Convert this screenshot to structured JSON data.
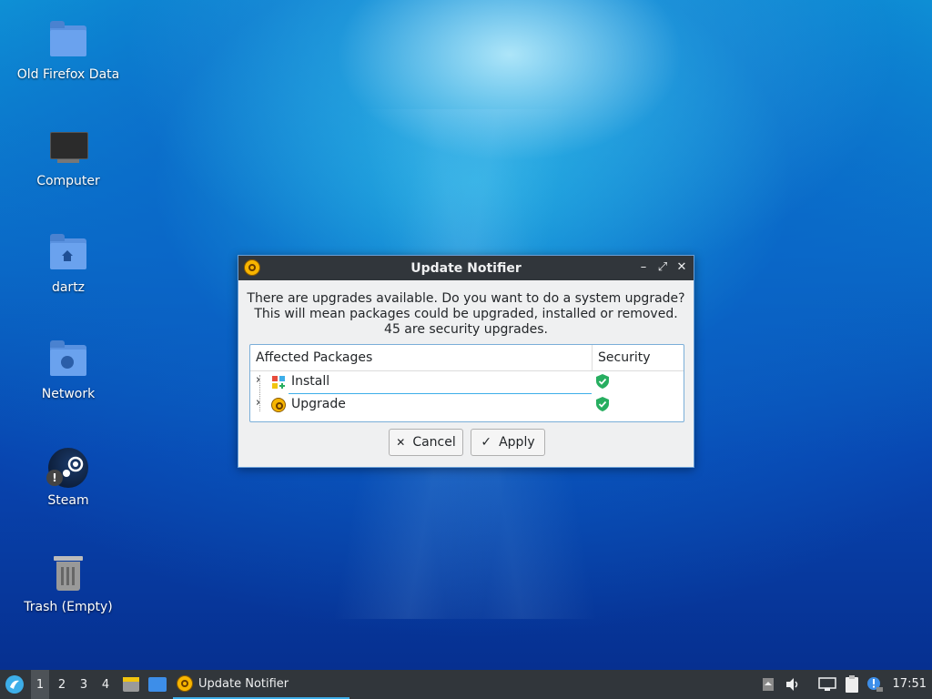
{
  "desktop": {
    "icons": [
      {
        "label": "Old Firefox Data",
        "icon": "folder-icon"
      },
      {
        "label": "Computer",
        "icon": "computer-icon"
      },
      {
        "label": "dartz",
        "icon": "home-folder-icon"
      },
      {
        "label": "Network",
        "icon": "network-folder-icon"
      },
      {
        "label": "Steam",
        "icon": "steam-icon"
      },
      {
        "label": "Trash (Empty)",
        "icon": "trash-icon"
      }
    ]
  },
  "dialog": {
    "title": "Update Notifier",
    "message_line1": "There are upgrades available. Do you want to do a system upgrade?",
    "message_line2": "This will mean packages could be upgraded, installed or removed.",
    "message_line3": "45 are security upgrades.",
    "columns": [
      "Affected Packages",
      "Security"
    ],
    "rows": [
      {
        "label": "Install",
        "icon": "install-icon",
        "security": "shield-check-icon"
      },
      {
        "label": "Upgrade",
        "icon": "upgrade-icon",
        "security": "shield-check-icon"
      }
    ],
    "cancel_label": "Cancel",
    "apply_label": "Apply",
    "title_buttons": {
      "minimize": "–",
      "maximize": "⤢",
      "close": "✕"
    }
  },
  "taskbar": {
    "desktops": [
      "1",
      "2",
      "3",
      "4"
    ],
    "active_desktop": "1",
    "task_label": "Update Notifier",
    "clock": "17:51"
  },
  "colors": {
    "accent": "#3daee9",
    "titlebar": "#31363b",
    "shield_green": "#27ae60"
  }
}
